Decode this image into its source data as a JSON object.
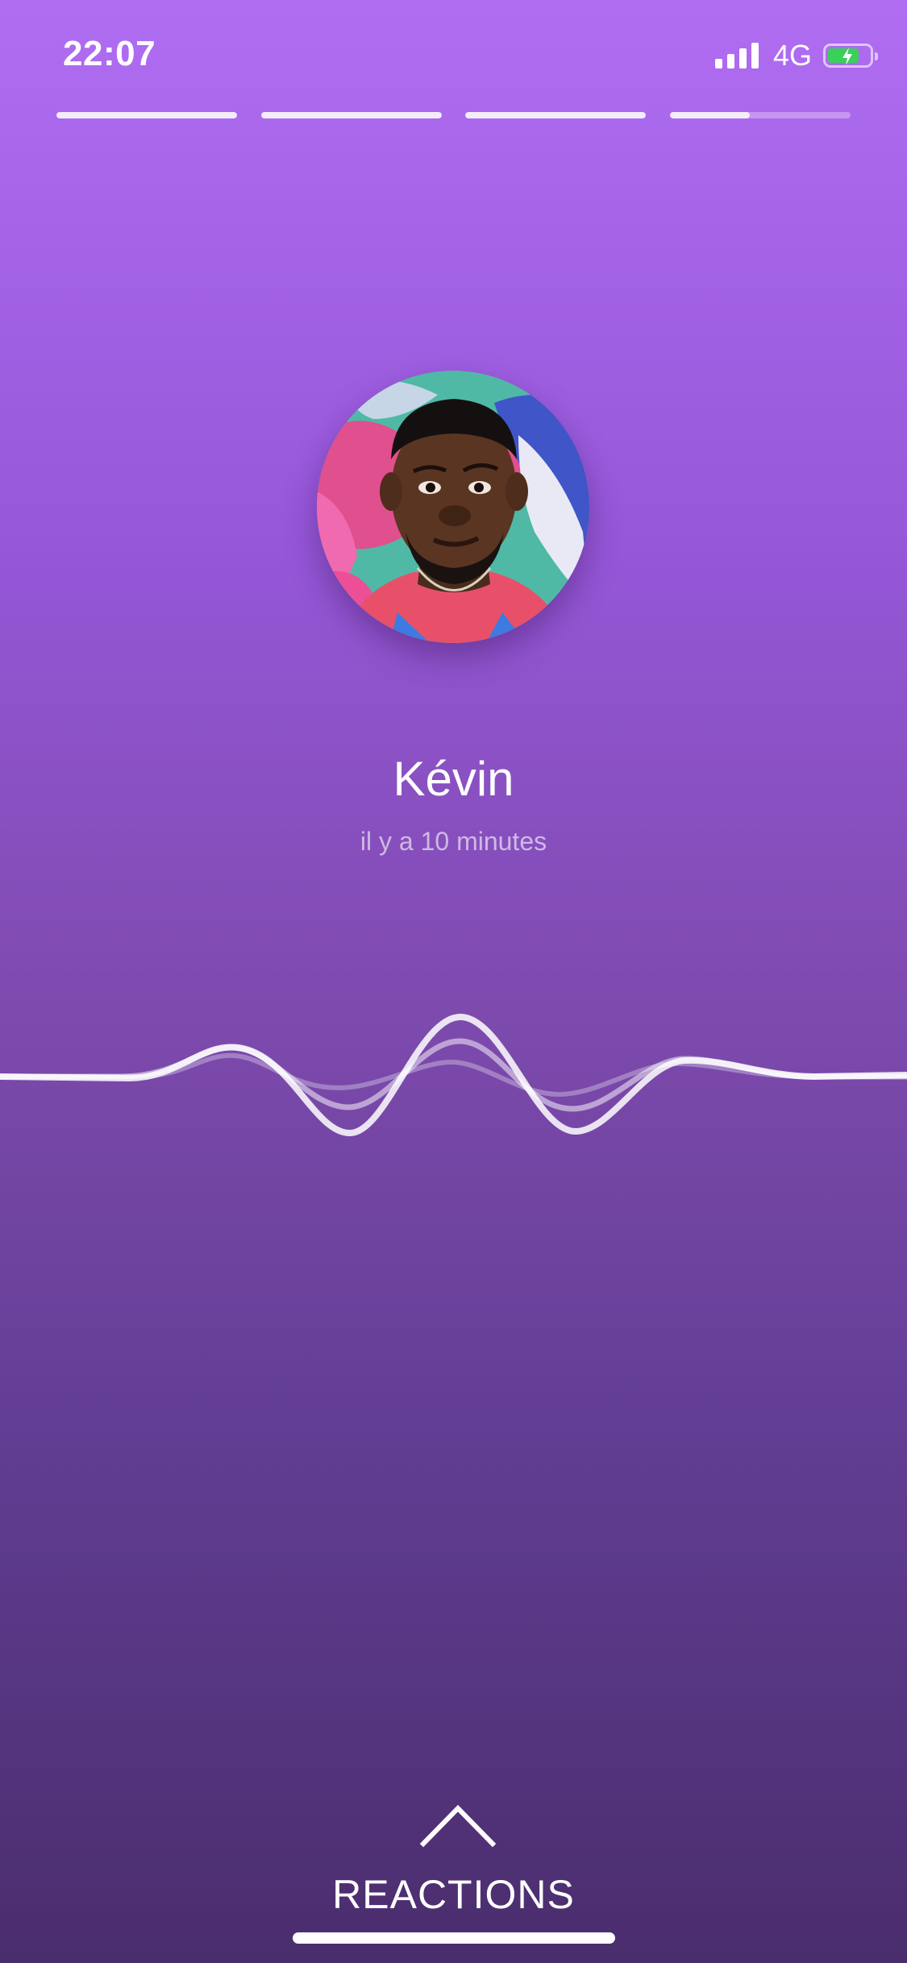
{
  "status_bar": {
    "time": "22:07",
    "network": "4G",
    "battery_level": 0.75,
    "battery_color": "#3ad05a",
    "signal_bars": 4
  },
  "story_progress": {
    "segments": [
      1,
      1,
      1,
      0.44
    ]
  },
  "profile": {
    "name": "Kévin",
    "time_ago": "il y a 10 minutes"
  },
  "reactions": {
    "label": "REACTIONS",
    "icon": "chevron-up-icon"
  },
  "colors": {
    "gradient_top": "#b06df2",
    "gradient_bottom": "#4a2d6d",
    "text": "#ffffff"
  }
}
